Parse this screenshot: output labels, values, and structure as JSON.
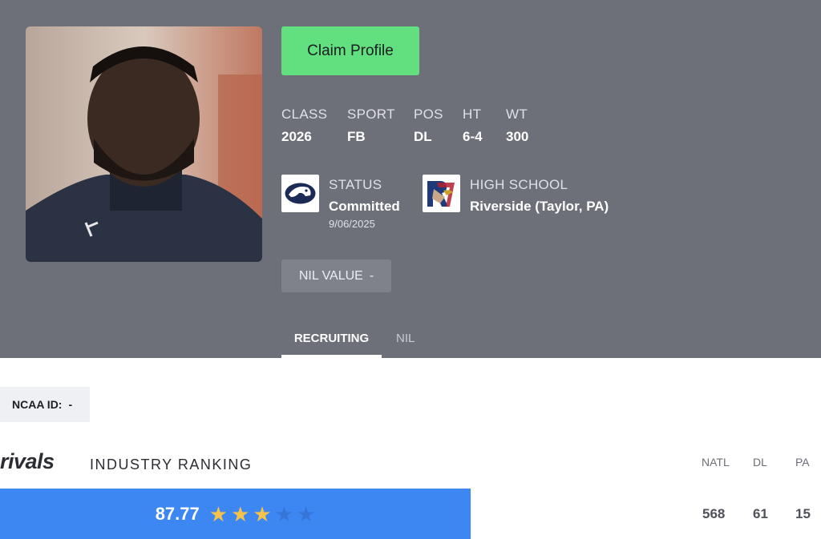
{
  "profile": {
    "claim_label": "Claim Profile",
    "stats": [
      {
        "label": "CLASS",
        "value": "2026"
      },
      {
        "label": "SPORT",
        "value": "FB"
      },
      {
        "label": "POS",
        "value": "DL"
      },
      {
        "label": "HT",
        "value": "6-4"
      },
      {
        "label": "WT",
        "value": "300"
      }
    ],
    "status": {
      "label": "STATUS",
      "value": "Committed",
      "date": "9/06/2025",
      "logo_icon": "penn-state-logo"
    },
    "high_school": {
      "label": "HIGH SCHOOL",
      "value": "Riverside (Taylor, PA)",
      "logo_icon": "riverside-logo"
    },
    "nil": {
      "label": "NIL VALUE",
      "value": "-"
    }
  },
  "tabs": [
    {
      "label": "RECRUITING",
      "active": true
    },
    {
      "label": "NIL",
      "active": false
    }
  ],
  "ncaa": {
    "label": "NCAA ID:",
    "value": "-"
  },
  "ranking": {
    "brand": "rivals",
    "title": "INDUSTRY RANKING",
    "rating": "87.77",
    "stars_filled": 3,
    "stars_total": 5,
    "columns": [
      {
        "label": "NATL",
        "value": "568"
      },
      {
        "label": "DL",
        "value": "61"
      },
      {
        "label": "PA",
        "value": "15"
      }
    ]
  },
  "colors": {
    "hero_bg": "#6d7079",
    "claim_btn": "#62e07f",
    "rating_bar": "#3d87f2",
    "star_on": "#f5c24c"
  }
}
